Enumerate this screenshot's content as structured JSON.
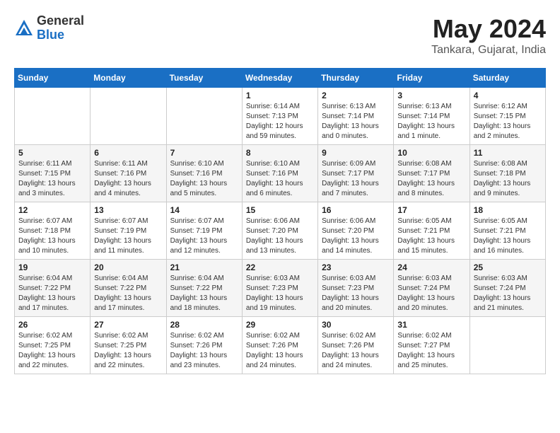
{
  "header": {
    "logo_general": "General",
    "logo_blue": "Blue",
    "title": "May 2024",
    "location": "Tankara, Gujarat, India"
  },
  "weekdays": [
    "Sunday",
    "Monday",
    "Tuesday",
    "Wednesday",
    "Thursday",
    "Friday",
    "Saturday"
  ],
  "weeks": [
    [
      {
        "day": "",
        "info": ""
      },
      {
        "day": "",
        "info": ""
      },
      {
        "day": "",
        "info": ""
      },
      {
        "day": "1",
        "info": "Sunrise: 6:14 AM\nSunset: 7:13 PM\nDaylight: 12 hours\nand 59 minutes."
      },
      {
        "day": "2",
        "info": "Sunrise: 6:13 AM\nSunset: 7:14 PM\nDaylight: 13 hours\nand 0 minutes."
      },
      {
        "day": "3",
        "info": "Sunrise: 6:13 AM\nSunset: 7:14 PM\nDaylight: 13 hours\nand 1 minute."
      },
      {
        "day": "4",
        "info": "Sunrise: 6:12 AM\nSunset: 7:15 PM\nDaylight: 13 hours\nand 2 minutes."
      }
    ],
    [
      {
        "day": "5",
        "info": "Sunrise: 6:11 AM\nSunset: 7:15 PM\nDaylight: 13 hours\nand 3 minutes."
      },
      {
        "day": "6",
        "info": "Sunrise: 6:11 AM\nSunset: 7:16 PM\nDaylight: 13 hours\nand 4 minutes."
      },
      {
        "day": "7",
        "info": "Sunrise: 6:10 AM\nSunset: 7:16 PM\nDaylight: 13 hours\nand 5 minutes."
      },
      {
        "day": "8",
        "info": "Sunrise: 6:10 AM\nSunset: 7:16 PM\nDaylight: 13 hours\nand 6 minutes."
      },
      {
        "day": "9",
        "info": "Sunrise: 6:09 AM\nSunset: 7:17 PM\nDaylight: 13 hours\nand 7 minutes."
      },
      {
        "day": "10",
        "info": "Sunrise: 6:08 AM\nSunset: 7:17 PM\nDaylight: 13 hours\nand 8 minutes."
      },
      {
        "day": "11",
        "info": "Sunrise: 6:08 AM\nSunset: 7:18 PM\nDaylight: 13 hours\nand 9 minutes."
      }
    ],
    [
      {
        "day": "12",
        "info": "Sunrise: 6:07 AM\nSunset: 7:18 PM\nDaylight: 13 hours\nand 10 minutes."
      },
      {
        "day": "13",
        "info": "Sunrise: 6:07 AM\nSunset: 7:19 PM\nDaylight: 13 hours\nand 11 minutes."
      },
      {
        "day": "14",
        "info": "Sunrise: 6:07 AM\nSunset: 7:19 PM\nDaylight: 13 hours\nand 12 minutes."
      },
      {
        "day": "15",
        "info": "Sunrise: 6:06 AM\nSunset: 7:20 PM\nDaylight: 13 hours\nand 13 minutes."
      },
      {
        "day": "16",
        "info": "Sunrise: 6:06 AM\nSunset: 7:20 PM\nDaylight: 13 hours\nand 14 minutes."
      },
      {
        "day": "17",
        "info": "Sunrise: 6:05 AM\nSunset: 7:21 PM\nDaylight: 13 hours\nand 15 minutes."
      },
      {
        "day": "18",
        "info": "Sunrise: 6:05 AM\nSunset: 7:21 PM\nDaylight: 13 hours\nand 16 minutes."
      }
    ],
    [
      {
        "day": "19",
        "info": "Sunrise: 6:04 AM\nSunset: 7:22 PM\nDaylight: 13 hours\nand 17 minutes."
      },
      {
        "day": "20",
        "info": "Sunrise: 6:04 AM\nSunset: 7:22 PM\nDaylight: 13 hours\nand 17 minutes."
      },
      {
        "day": "21",
        "info": "Sunrise: 6:04 AM\nSunset: 7:22 PM\nDaylight: 13 hours\nand 18 minutes."
      },
      {
        "day": "22",
        "info": "Sunrise: 6:03 AM\nSunset: 7:23 PM\nDaylight: 13 hours\nand 19 minutes."
      },
      {
        "day": "23",
        "info": "Sunrise: 6:03 AM\nSunset: 7:23 PM\nDaylight: 13 hours\nand 20 minutes."
      },
      {
        "day": "24",
        "info": "Sunrise: 6:03 AM\nSunset: 7:24 PM\nDaylight: 13 hours\nand 20 minutes."
      },
      {
        "day": "25",
        "info": "Sunrise: 6:03 AM\nSunset: 7:24 PM\nDaylight: 13 hours\nand 21 minutes."
      }
    ],
    [
      {
        "day": "26",
        "info": "Sunrise: 6:02 AM\nSunset: 7:25 PM\nDaylight: 13 hours\nand 22 minutes."
      },
      {
        "day": "27",
        "info": "Sunrise: 6:02 AM\nSunset: 7:25 PM\nDaylight: 13 hours\nand 22 minutes."
      },
      {
        "day": "28",
        "info": "Sunrise: 6:02 AM\nSunset: 7:26 PM\nDaylight: 13 hours\nand 23 minutes."
      },
      {
        "day": "29",
        "info": "Sunrise: 6:02 AM\nSunset: 7:26 PM\nDaylight: 13 hours\nand 24 minutes."
      },
      {
        "day": "30",
        "info": "Sunrise: 6:02 AM\nSunset: 7:26 PM\nDaylight: 13 hours\nand 24 minutes."
      },
      {
        "day": "31",
        "info": "Sunrise: 6:02 AM\nSunset: 7:27 PM\nDaylight: 13 hours\nand 25 minutes."
      },
      {
        "day": "",
        "info": ""
      }
    ]
  ]
}
